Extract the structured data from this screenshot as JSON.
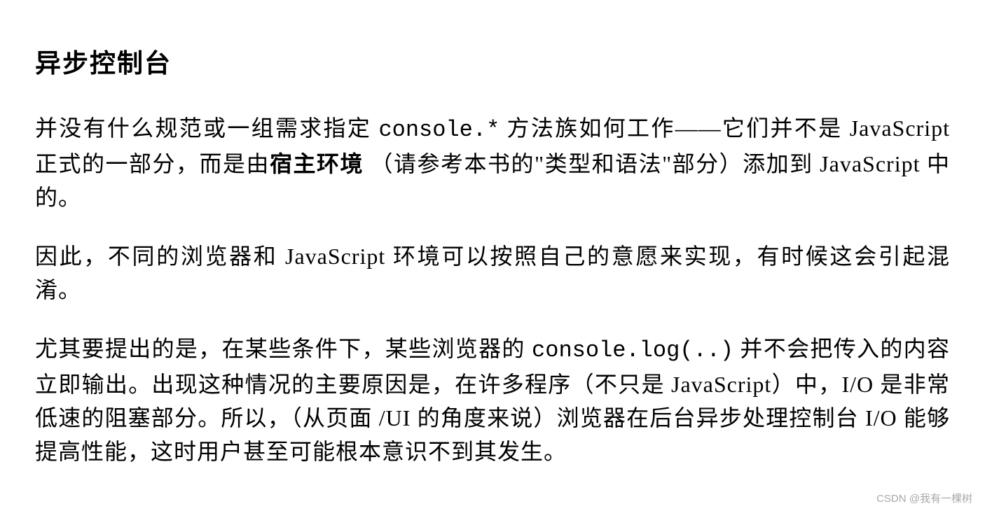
{
  "heading": "异步控制台",
  "p1_seg1": "并没有什么规范或一组需求指定 ",
  "p1_code1": "console.*",
  "p1_seg2": " 方法族如何工作——它们并不是 JavaScript 正式的一部分，而是由",
  "p1_bold": "宿主环境",
  "p1_seg3": " （请参考本书的\"类型和语法\"部分）添加到 JavaScript 中的。",
  "p2": "因此，不同的浏览器和 JavaScript 环境可以按照自己的意愿来实现，有时候这会引起混淆。",
  "p3_seg1": "尤其要提出的是，在某些条件下，某些浏览器的 ",
  "p3_code1": "console.log(..)",
  "p3_seg2": " 并不会把传入的内容立即输出。出现这种情况的主要原因是，在许多程序（不只是 JavaScript）中，I/O 是非常低速的阻塞部分。所以，（从页面 /UI 的角度来说）浏览器在后台异步处理控制台 I/O 能够提高性能，这时用户甚至可能根本意识不到其发生。",
  "watermark": "CSDN @我有一棵树"
}
